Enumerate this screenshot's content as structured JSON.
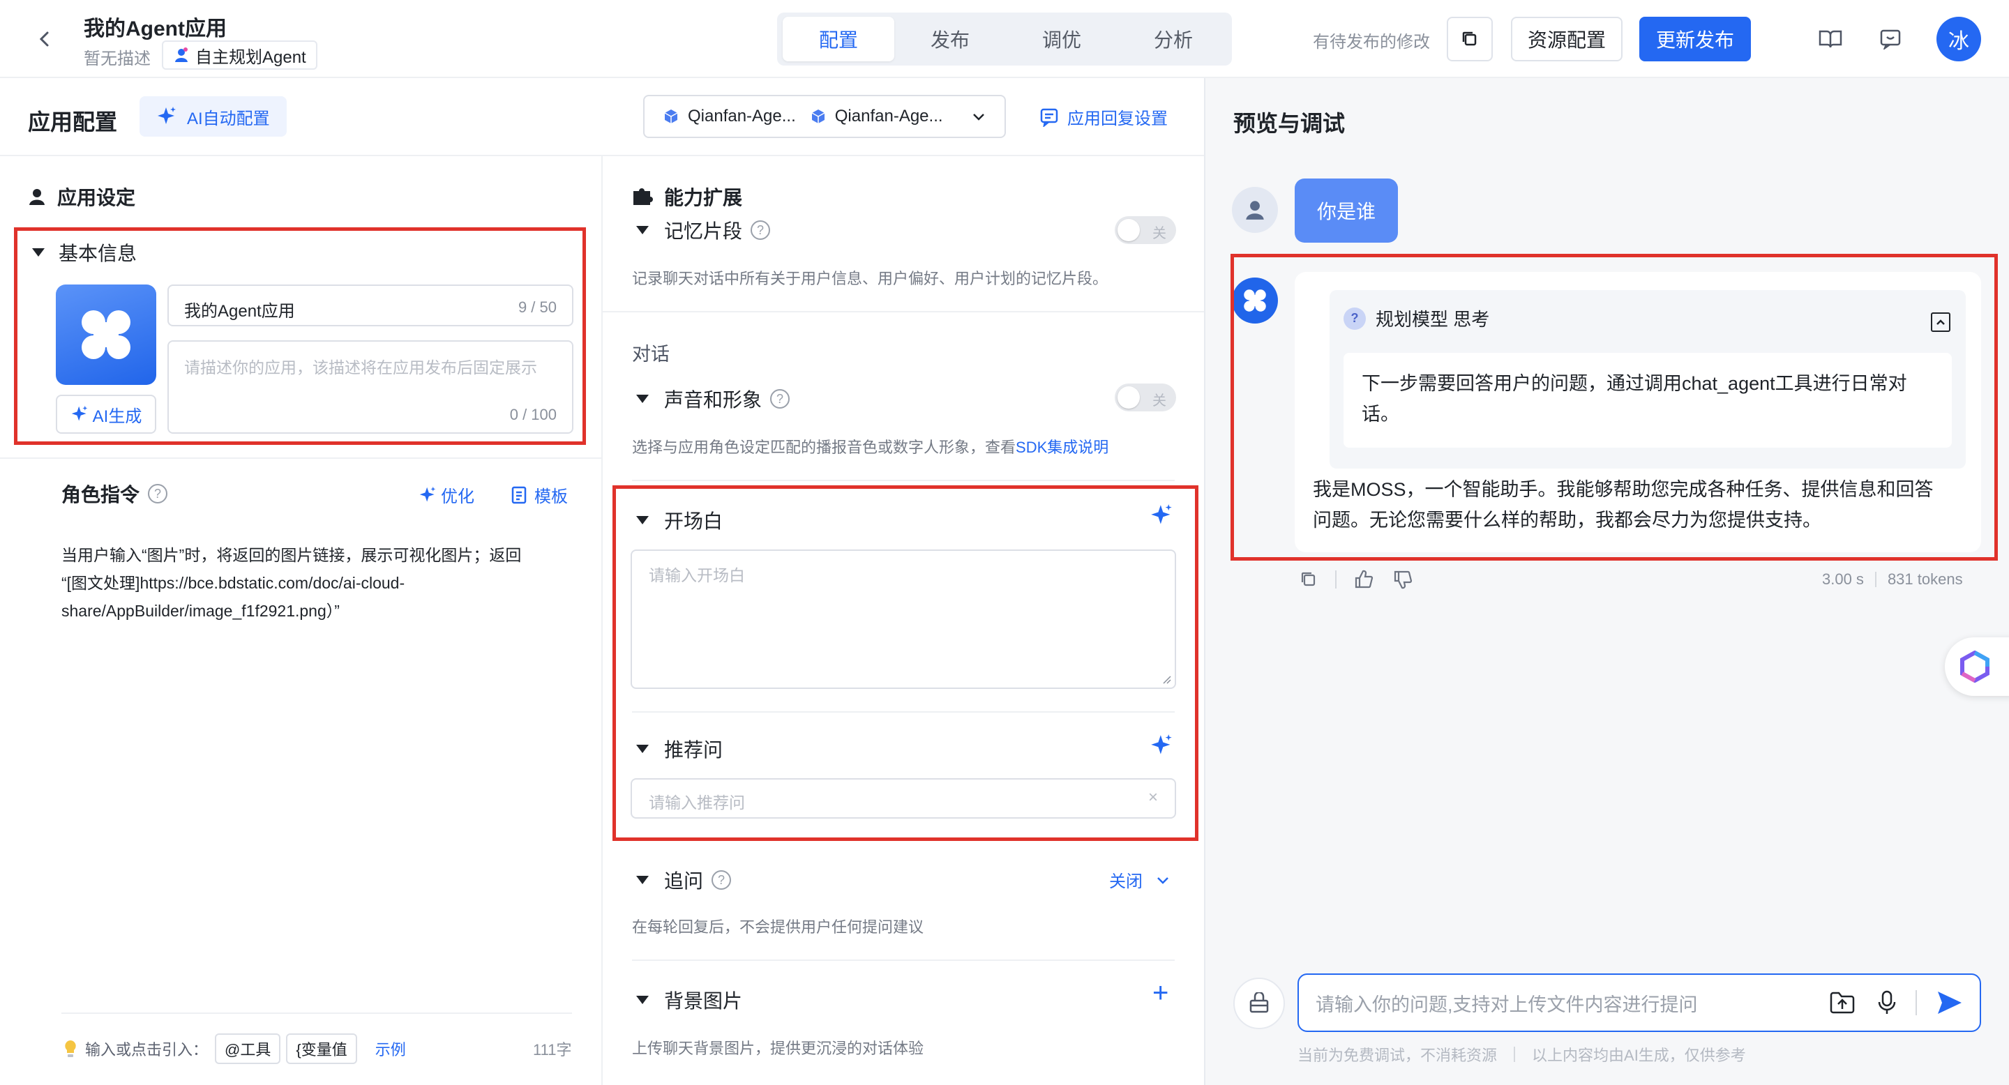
{
  "header": {
    "app_name": "我的Agent应用",
    "description": "暂无描述",
    "agent_type": "自主规划Agent",
    "tabs": [
      "配置",
      "发布",
      "调优",
      "分析"
    ],
    "pending_text": "有待发布的修改",
    "resource_button": "资源配置",
    "publish_button": "更新发布",
    "avatar_char": "冰"
  },
  "config": {
    "title": "应用配置",
    "ai_auto_config": "AI自动配置",
    "model_1": "Qianfan-Age...",
    "model_2": "Qianfan-Age...",
    "reply_settings": "应用回复设置"
  },
  "app_settings": {
    "section_title": "应用设定",
    "basic_info_title": "基本信息",
    "name_value": "我的Agent应用",
    "name_count": "9 / 50",
    "desc_placeholder": "请描述你的应用，该描述将在应用发布后固定展示",
    "desc_count": "0 / 100",
    "ai_generate": "AI生成",
    "role_title": "角色指令",
    "optimize": "优化",
    "template": "模板",
    "role_line1": "当用户输入“图片”时，将返回的图片链接，展示可视化图片；返回",
    "role_line2": "“[图文处理]https://bce.bdstatic.com/doc/ai-cloud-",
    "role_line3": "share/AppBuilder/image_f1f2921.png）”",
    "footer_hint": "输入或点击引入：",
    "chip_tool": "@工具",
    "chip_var": "{变量值",
    "example": "示例",
    "char_count": "111字"
  },
  "capabilities": {
    "title": "能力扩展",
    "memory_title": "记忆片段",
    "memory_toggle": "关",
    "memory_desc": "记录聊天对话中所有关于用户信息、用户偏好、用户计划的记忆片段。",
    "dialog_title": "对话",
    "voice_title": "声音和形象",
    "voice_toggle": "关",
    "voice_desc": "选择与应用角色设定匹配的播报音色或数字人形象，查看",
    "voice_link": "SDK集成说明",
    "opening_title": "开场白",
    "opening_placeholder": "请输入开场白",
    "recommend_title": "推荐问",
    "recommend_placeholder": "请输入推荐问",
    "followup_title": "追问",
    "followup_state": "关闭",
    "followup_desc": "在每轮回复后，不会提供用户任何提问建议",
    "bg_title": "背景图片",
    "bg_desc": "上传聊天背景图片，提供更沉浸的对话体验"
  },
  "preview": {
    "title": "预览与调试",
    "user_message": "你是谁",
    "think_title": "规划模型 思考",
    "think_line1": "下一步需要回答用户的问题，通过调用chat_agent工具进行日常对",
    "think_line2": "话。",
    "answer_line1": "我是MOSS，一个智能助手。我能够帮助您完成各种任务、提供信息和回答",
    "answer_line2": "问题。无论您需要什么样的帮助，我都会尽力为您提供支持。",
    "time": "3.00 s",
    "tokens": "831 tokens",
    "input_placeholder": "请输入你的问题,支持对上传文件内容进行提问",
    "footer_note1": "当前为免费调试，不消耗资源",
    "footer_note2": "以上内容均由AI生成，仅供参考"
  },
  "colors": {
    "accent": "#2468f2",
    "highlight_box": "#e0322b",
    "user_bubble": "#5a8cf6"
  }
}
